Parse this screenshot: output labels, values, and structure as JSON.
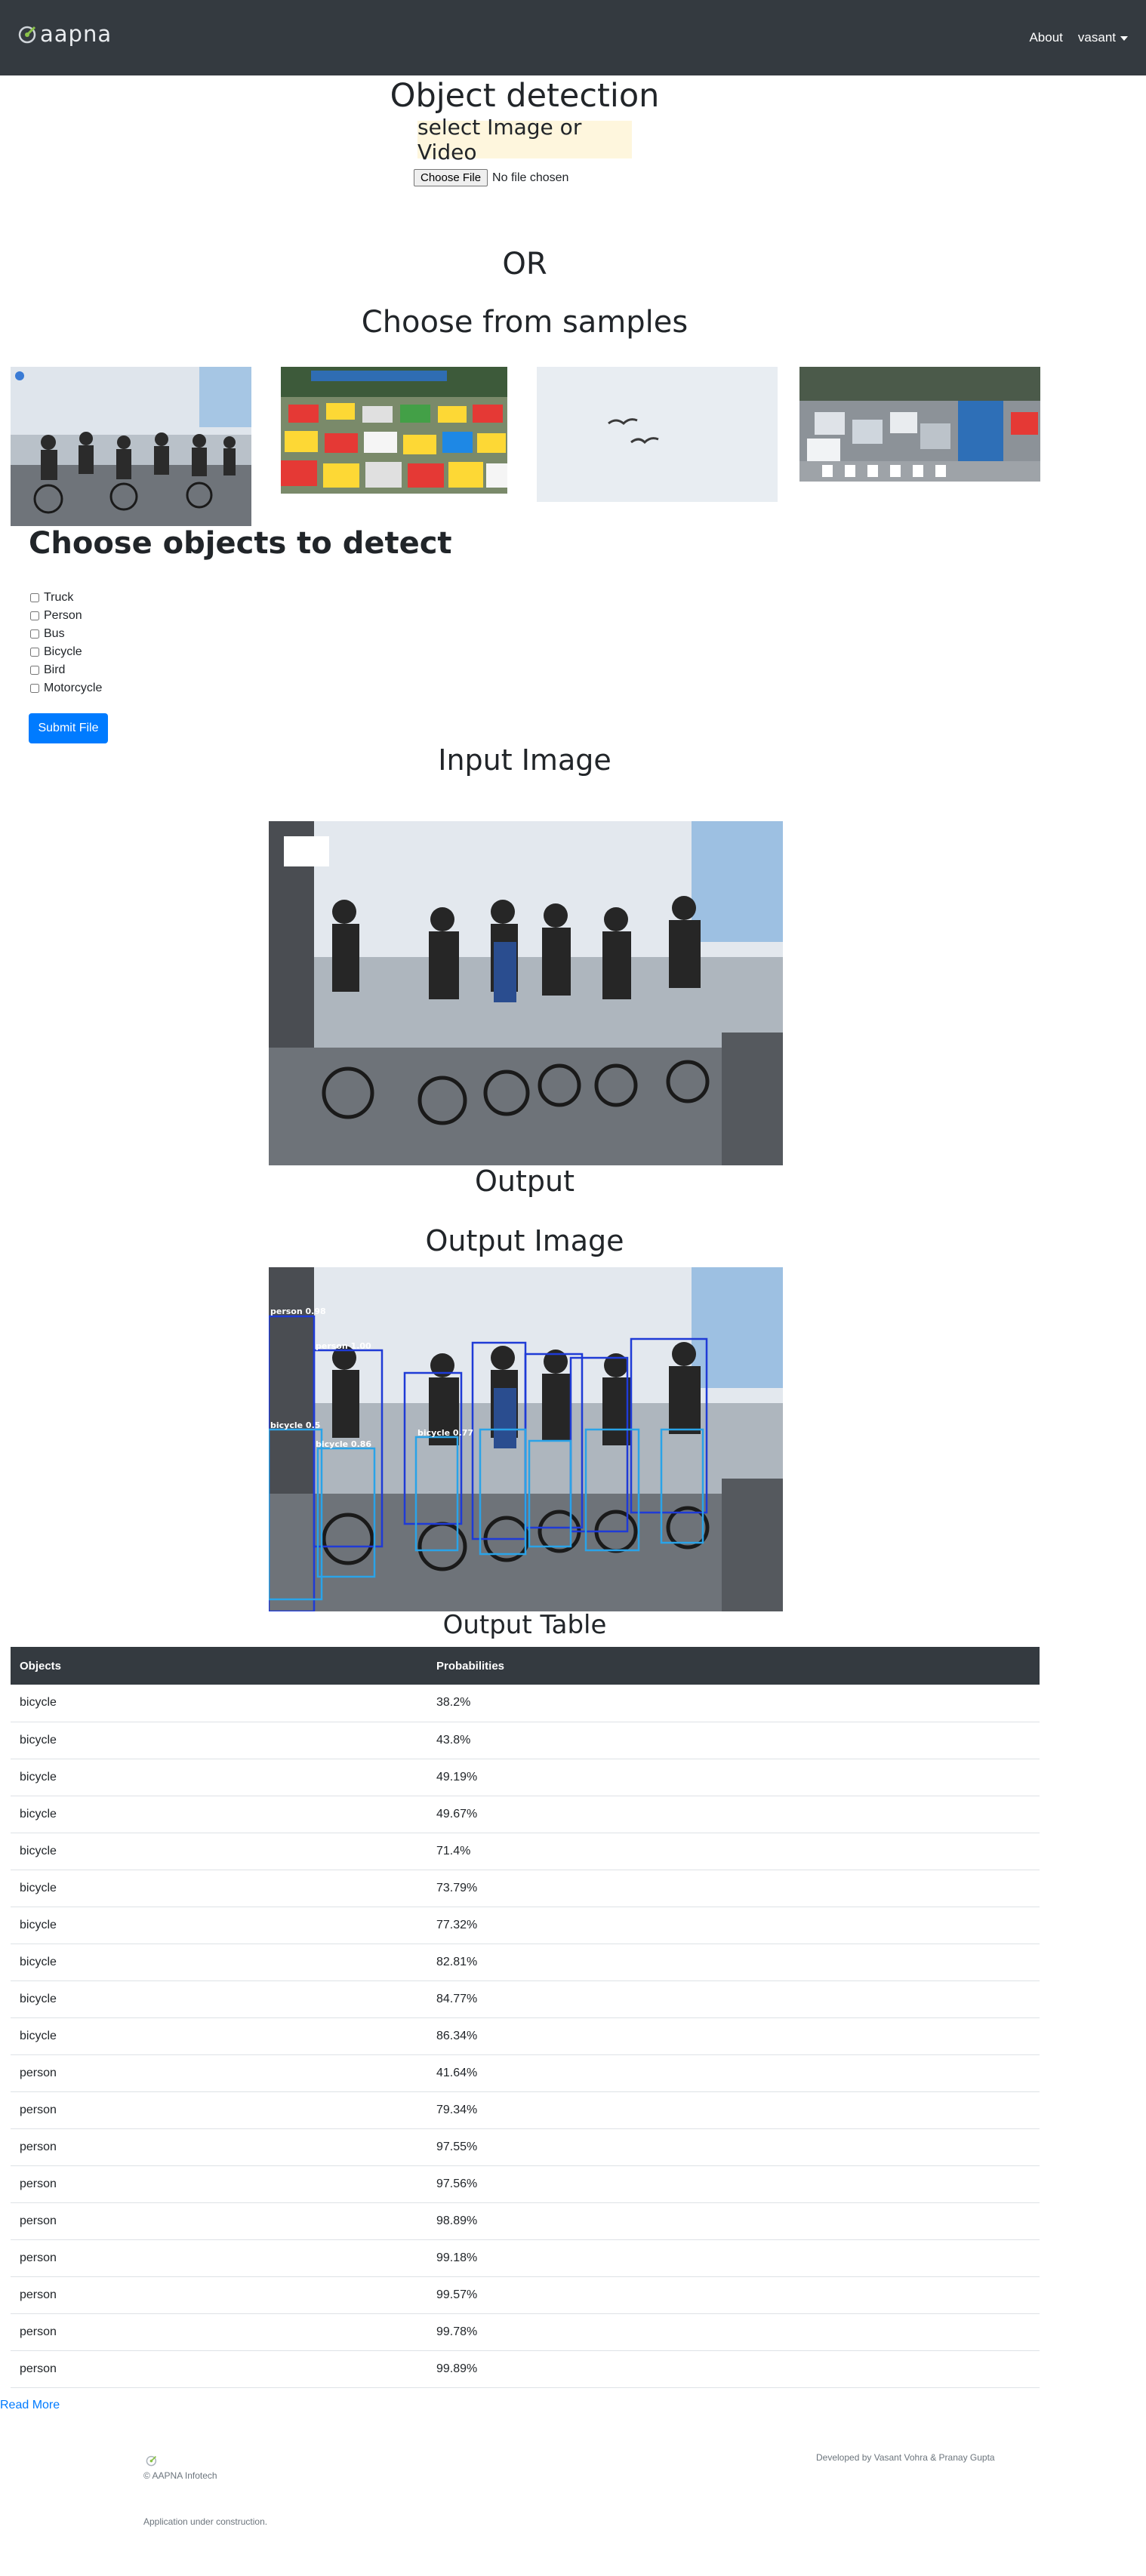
{
  "navbar": {
    "brand": "aapna",
    "links": {
      "about": "About",
      "user": "vasant"
    }
  },
  "page": {
    "title": "Object detection",
    "select_label": "select Image or Video",
    "file_button": "Choose File",
    "file_status": "No file chosen",
    "or_text": "OR",
    "samples_title": "Choose from samples",
    "samples": [
      "cyclists",
      "traffic-jam",
      "birds",
      "city-traffic"
    ]
  },
  "objects": {
    "title": "Choose objects to detect",
    "options": [
      "Truck",
      "Person",
      "Bus",
      "Bicycle",
      "Bird",
      "Motorcycle"
    ],
    "submit_label": "Submit File"
  },
  "results": {
    "input_title": "Input Image",
    "output_title": "Output",
    "output_image_title": "Output Image",
    "table_title": "Output Table",
    "columns": [
      "Objects",
      "Probabilities"
    ],
    "rows": [
      [
        "bicycle",
        "38.2%"
      ],
      [
        "bicycle",
        "43.8%"
      ],
      [
        "bicycle",
        "49.19%"
      ],
      [
        "bicycle",
        "49.67%"
      ],
      [
        "bicycle",
        "71.4%"
      ],
      [
        "bicycle",
        "73.79%"
      ],
      [
        "bicycle",
        "77.32%"
      ],
      [
        "bicycle",
        "82.81%"
      ],
      [
        "bicycle",
        "84.77%"
      ],
      [
        "bicycle",
        "86.34%"
      ],
      [
        "person",
        "41.64%"
      ],
      [
        "person",
        "79.34%"
      ],
      [
        "person",
        "97.55%"
      ],
      [
        "person",
        "97.56%"
      ],
      [
        "person",
        "98.89%"
      ],
      [
        "person",
        "99.18%"
      ],
      [
        "person",
        "99.57%"
      ],
      [
        "person",
        "99.78%"
      ],
      [
        "person",
        "99.89%"
      ]
    ],
    "detection_labels": [
      "person 0.98",
      "person 1.00",
      "bicycle 0.5",
      "bicycle 0.86",
      "bicycle 0.77"
    ]
  },
  "footer": {
    "read_more": "Read More",
    "copyright": "© AAPNA Infotech",
    "developed_by": "Developed by Vasant Vohra & Pranay Gupta",
    "note": "Application under construction."
  },
  "colors": {
    "navbar": "#343a40",
    "accent": "#007bff",
    "highlight": "#fef6dd",
    "box_blue": "#1f3bd6",
    "box_cyan": "#2aa3e8"
  }
}
